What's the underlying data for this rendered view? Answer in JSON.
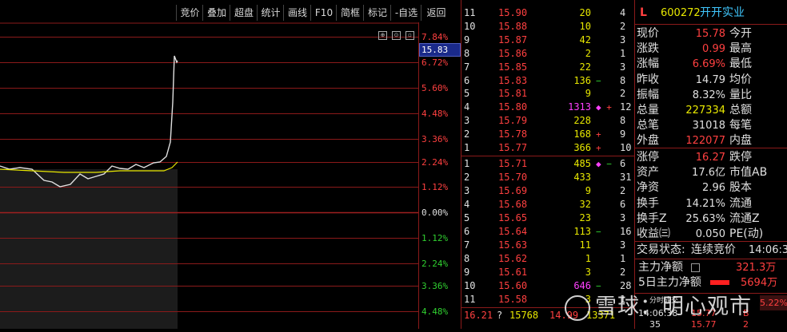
{
  "toolbar": {
    "items": [
      "竞价",
      "叠加",
      "超盘",
      "统计",
      "画线",
      "F10",
      "简框",
      "标记",
      "-自选",
      "返回"
    ]
  },
  "chart": {
    "price_tag": "15.83",
    "pct_labels": [
      {
        "text": "7.84%",
        "cls": "red"
      },
      {
        "text": "6.72%",
        "cls": "red"
      },
      {
        "text": "5.60%",
        "cls": "red"
      },
      {
        "text": "4.48%",
        "cls": "red"
      },
      {
        "text": "3.36%",
        "cls": "red"
      },
      {
        "text": "2.24%",
        "cls": "red"
      },
      {
        "text": "1.12%",
        "cls": "red"
      },
      {
        "text": "0.00%",
        "cls": "wht"
      },
      {
        "text": "1.12%",
        "cls": "grn"
      },
      {
        "text": "2.24%",
        "cls": "grn"
      },
      {
        "text": "3.36%",
        "cls": "grn"
      },
      {
        "text": "4.48%",
        "cls": "grn"
      }
    ]
  },
  "book": {
    "asks": [
      {
        "idx": "11",
        "price": "15.90",
        "vol": "20",
        "mark": "",
        "tail": "4"
      },
      {
        "idx": "10",
        "price": "15.88",
        "vol": "10",
        "mark": "",
        "tail": "2"
      },
      {
        "idx": "9",
        "price": "15.87",
        "vol": "42",
        "mark": "",
        "tail": "3"
      },
      {
        "idx": "8",
        "price": "15.86",
        "vol": "2",
        "mark": "",
        "tail": "1"
      },
      {
        "idx": "7",
        "price": "15.85",
        "vol": "22",
        "mark": "",
        "tail": "3"
      },
      {
        "idx": "6",
        "price": "15.83",
        "vol": "136",
        "mark": "−",
        "tail": "8"
      },
      {
        "idx": "5",
        "price": "15.81",
        "vol": "9",
        "mark": "",
        "tail": "2"
      },
      {
        "idx": "4",
        "price": "15.80",
        "vol": "1313",
        "mark": "◆ +",
        "tail": "12"
      },
      {
        "idx": "3",
        "price": "15.79",
        "vol": "228",
        "mark": "",
        "tail": "8"
      },
      {
        "idx": "2",
        "price": "15.78",
        "vol": "168",
        "mark": "+",
        "tail": "9"
      },
      {
        "idx": "1",
        "price": "15.77",
        "vol": "366",
        "mark": "+",
        "tail": "10"
      }
    ],
    "bids": [
      {
        "idx": "1",
        "price": "15.71",
        "vol": "485",
        "mark": "◆ −",
        "tail": "6"
      },
      {
        "idx": "2",
        "price": "15.70",
        "vol": "433",
        "mark": "",
        "tail": "31"
      },
      {
        "idx": "3",
        "price": "15.69",
        "vol": "9",
        "mark": "",
        "tail": "2"
      },
      {
        "idx": "4",
        "price": "15.68",
        "vol": "32",
        "mark": "",
        "tail": "6"
      },
      {
        "idx": "5",
        "price": "15.65",
        "vol": "23",
        "mark": "",
        "tail": "3"
      },
      {
        "idx": "6",
        "price": "15.64",
        "vol": "113",
        "mark": "−",
        "tail": "16"
      },
      {
        "idx": "7",
        "price": "15.63",
        "vol": "11",
        "mark": "",
        "tail": "3"
      },
      {
        "idx": "8",
        "price": "15.62",
        "vol": "1",
        "mark": "",
        "tail": "1"
      },
      {
        "idx": "9",
        "price": "15.61",
        "vol": "3",
        "mark": "",
        "tail": "2"
      },
      {
        "idx": "10",
        "price": "15.60",
        "vol": "646",
        "mark": "−",
        "tail": "28"
      },
      {
        "idx": "11",
        "price": "15.58",
        "vol": "3",
        "mark": "",
        "tail": "1"
      }
    ],
    "footer": {
      "price": "16.21",
      "q": "?",
      "v1": "15768",
      "p2": "14.99",
      "v2": "13371"
    }
  },
  "info": {
    "flag": "L",
    "code": "600272",
    "name": "开开实业",
    "quote_rows": [
      {
        "l": "现价",
        "v": "15.78",
        "vc": "red",
        "r": "今开"
      },
      {
        "l": "涨跌",
        "v": "0.99",
        "vc": "red",
        "r": "最高"
      },
      {
        "l": "涨幅",
        "v": "6.69%",
        "vc": "red",
        "r": "最低"
      },
      {
        "l": "昨收",
        "v": "14.79",
        "vc": "wht",
        "r": "均价"
      },
      {
        "l": "振幅",
        "v": "8.32%",
        "vc": "wht",
        "r": "量比"
      },
      {
        "l": "总量",
        "v": "227334",
        "vc": "yel",
        "r": "总额"
      },
      {
        "l": "总笔",
        "v": "31018",
        "vc": "wht",
        "r": "每笔"
      },
      {
        "l": "外盘",
        "v": "122077",
        "vc": "red",
        "r": "内盘"
      }
    ],
    "fund_rows": [
      {
        "l": "涨停",
        "v": "16.27",
        "vc": "red",
        "r": "跌停"
      },
      {
        "l": "资产",
        "v": "17.6亿",
        "vc": "wht",
        "r": "市值AB"
      },
      {
        "l": "净资",
        "v": "2.96",
        "vc": "wht",
        "r": "股本"
      },
      {
        "l": "换手",
        "v": "14.21%",
        "vc": "wht",
        "r": "流通"
      },
      {
        "l": "换手Z",
        "v": "25.63%",
        "vc": "wht",
        "r": "流通Z"
      },
      {
        "l": "收益㈢",
        "v": "0.050",
        "vc": "wht",
        "r": "PE(动)"
      }
    ],
    "status_label": "交易状态:",
    "status_value": "连续竞价",
    "status_time": "14:06:3",
    "main_net_label": "主力净额",
    "main_net_value": "321.3万",
    "five_day_label": "5日主力净额",
    "five_day_value": "5694万",
    "tick_time": "14:06:38",
    "tick_price": "15.77",
    "tick_pct": "5.22%",
    "tick_b": "B",
    "bottom_vals": [
      "35",
      "15.77",
      "2"
    ]
  },
  "watermark": "雪球：明心观市",
  "colors": {
    "border": "#8b1a1a",
    "price_line": "#e0e0e0",
    "avg_line": "#e8e800",
    "up": "#ff4040",
    "down": "#30d030"
  }
}
